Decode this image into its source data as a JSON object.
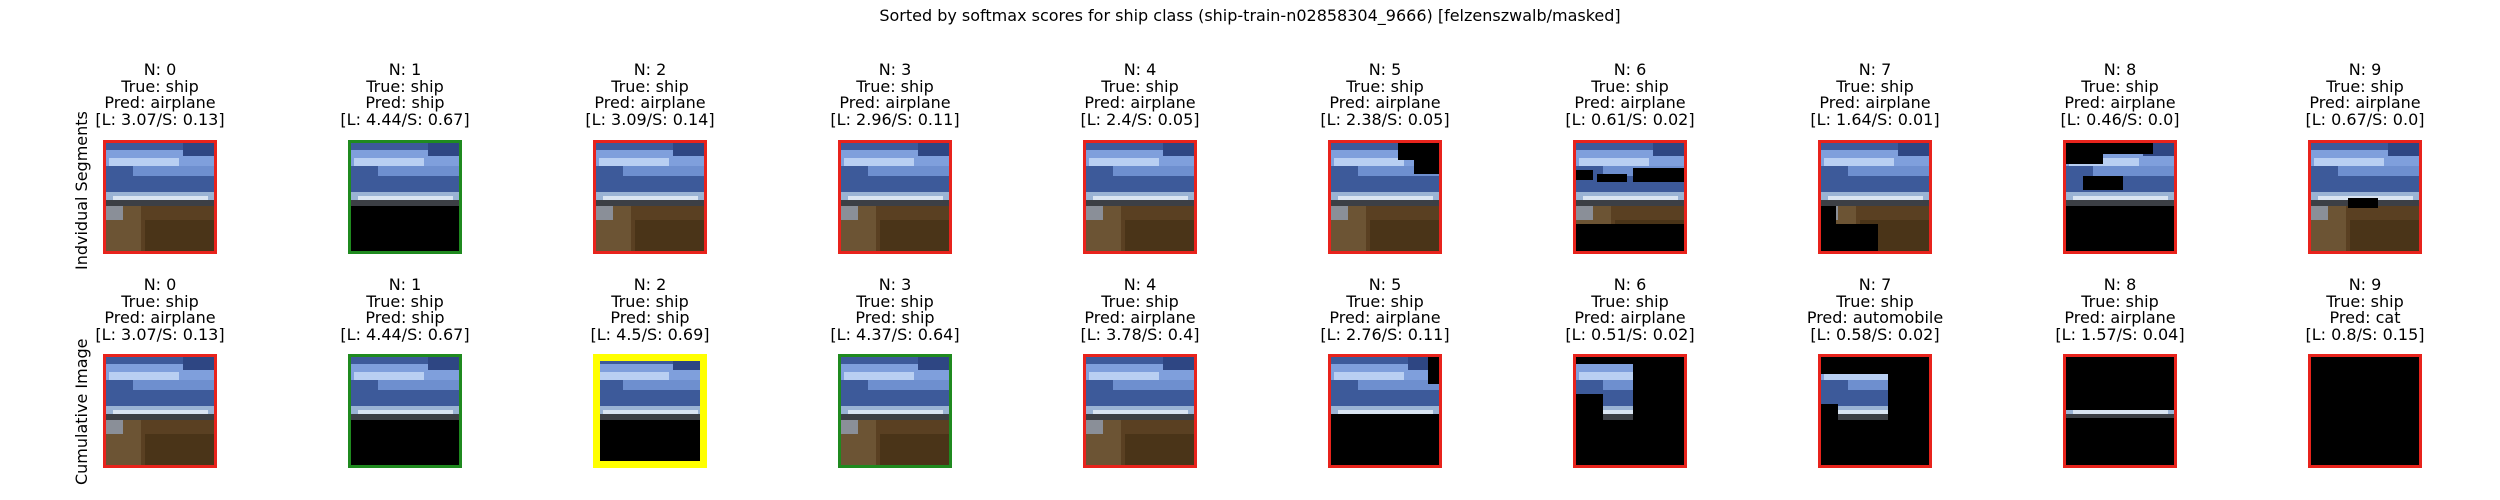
{
  "figure": {
    "title": "Sorted by softmax scores for ship class (ship-train-n02858304_9666) [felzenszwalb/masked]",
    "rows": [
      {
        "label": "Indvidual Segments",
        "panels": [
          {
            "n": "N: 0",
            "true_label": "True: ship",
            "pred": "Pred: airplane",
            "scores": "[L: 3.07/S: 0.13]",
            "border": "#e8231c",
            "mask": "full"
          },
          {
            "n": "N: 1",
            "true_label": "True: ship",
            "pred": "Pred: ship",
            "scores": "[L: 4.44/S: 0.67]",
            "border": "#1f8a1f",
            "mask": "top-sky-only"
          },
          {
            "n": "N: 2",
            "true_label": "True: ship",
            "pred": "Pred: airplane",
            "scores": "[L: 3.09/S: 0.14]",
            "border": "#e8231c",
            "mask": "full"
          },
          {
            "n": "N: 3",
            "true_label": "True: ship",
            "pred": "Pred: airplane",
            "scores": "[L: 2.96/S: 0.11]",
            "border": "#e8231c",
            "mask": "full"
          },
          {
            "n": "N: 4",
            "true_label": "True: ship",
            "pred": "Pred: airplane",
            "scores": "[L: 2.4/S: 0.05]",
            "border": "#e8231c",
            "mask": "full"
          },
          {
            "n": "N: 5",
            "true_label": "True: ship",
            "pred": "Pred: airplane",
            "scores": "[L: 2.38/S: 0.05]",
            "border": "#e8231c",
            "mask": "sky-corner-cut"
          },
          {
            "n": "N: 6",
            "true_label": "True: ship",
            "pred": "Pred: airplane",
            "scores": "[L: 0.61/S: 0.02]",
            "border": "#e8231c",
            "mask": "sky-holes"
          },
          {
            "n": "N: 7",
            "true_label": "True: ship",
            "pred": "Pred: airplane",
            "scores": "[L: 1.64/S: 0.01]",
            "border": "#e8231c",
            "mask": "bottom-left-cut"
          },
          {
            "n": "N: 8",
            "true_label": "True: ship",
            "pred": "Pred: airplane",
            "scores": "[L: 0.46/S: 0.0]",
            "border": "#e8231c",
            "mask": "top-blob-cut"
          },
          {
            "n": "N: 9",
            "true_label": "True: ship",
            "pred": "Pred: airplane",
            "scores": "[L: 0.67/S: 0.0]",
            "border": "#e8231c",
            "mask": "small-cut"
          }
        ]
      },
      {
        "label": "Cumulative Image",
        "panels": [
          {
            "n": "N: 0",
            "true_label": "True: ship",
            "pred": "Pred: airplane",
            "scores": "[L: 3.07/S: 0.13]",
            "border": "#e8231c",
            "mask": "full"
          },
          {
            "n": "N: 1",
            "true_label": "True: ship",
            "pred": "Pred: ship",
            "scores": "[L: 4.44/S: 0.67]",
            "border": "#1f8a1f",
            "mask": "top-sky-only"
          },
          {
            "n": "N: 2",
            "true_label": "True: ship",
            "pred": "Pred: ship",
            "scores": "[L: 4.5/S: 0.69]",
            "border": "#ffff00",
            "mask": "top-sky-only",
            "highlight": true
          },
          {
            "n": "N: 3",
            "true_label": "True: ship",
            "pred": "Pred: ship",
            "scores": "[L: 4.37/S: 0.64]",
            "border": "#1f8a1f",
            "mask": "full"
          },
          {
            "n": "N: 4",
            "true_label": "True: ship",
            "pred": "Pred: airplane",
            "scores": "[L: 3.78/S: 0.4]",
            "border": "#e8231c",
            "mask": "full"
          },
          {
            "n": "N: 5",
            "true_label": "True: ship",
            "pred": "Pred: airplane",
            "scores": "[L: 2.76/S: 0.11]",
            "border": "#e8231c",
            "mask": "sky-only"
          },
          {
            "n": "N: 6",
            "true_label": "True: ship",
            "pred": "Pred: airplane",
            "scores": "[L: 0.51/S: 0.02]",
            "border": "#e8231c",
            "mask": "sky-blob"
          },
          {
            "n": "N: 7",
            "true_label": "True: ship",
            "pred": "Pred: automobile",
            "scores": "[L: 0.58/S: 0.02]",
            "border": "#e8231c",
            "mask": "small-sky-blob"
          },
          {
            "n": "N: 8",
            "true_label": "True: ship",
            "pred": "Pred: airplane",
            "scores": "[L: 1.57/S: 0.04]",
            "border": "#e8231c",
            "mask": "ship-sliver"
          },
          {
            "n": "N: 9",
            "true_label": "True: ship",
            "pred": "Pred: cat",
            "scores": "[L: 0.8/S: 0.15]",
            "border": "#e8231c",
            "mask": "black"
          }
        ]
      }
    ]
  }
}
